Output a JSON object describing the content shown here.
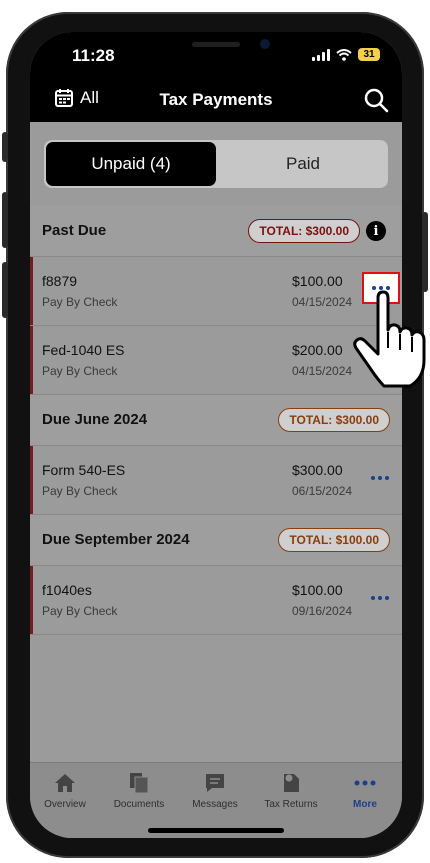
{
  "status_bar": {
    "time": "11:28",
    "battery": "31"
  },
  "nav": {
    "left_label": "All",
    "title": "Tax Payments"
  },
  "segment": {
    "unpaid": "Unpaid (4)",
    "paid": "Paid"
  },
  "sections": [
    {
      "title": "Past Due",
      "total": "TOTAL: $300.00",
      "rows": [
        {
          "name": "f8879",
          "method": "Pay By Check",
          "amount": "$100.00",
          "date": "04/15/2024"
        },
        {
          "name": "Fed-1040 ES",
          "method": "Pay By Check",
          "amount": "$200.00",
          "date": "04/15/2024"
        }
      ]
    },
    {
      "title": "Due June 2024",
      "total": "TOTAL: $300.00",
      "rows": [
        {
          "name": "Form 540-ES",
          "method": "Pay By Check",
          "amount": "$300.00",
          "date": "06/15/2024"
        }
      ]
    },
    {
      "title": "Due September 2024",
      "total": "TOTAL: $100.00",
      "rows": [
        {
          "name": "f1040es",
          "method": "Pay By Check",
          "amount": "$100.00",
          "date": "09/16/2024"
        }
      ]
    }
  ],
  "tabbar": [
    {
      "label": "Overview",
      "icon": "home-icon"
    },
    {
      "label": "Documents",
      "icon": "documents-icon"
    },
    {
      "label": "Messages",
      "icon": "messages-icon"
    },
    {
      "label": "Tax Returns",
      "icon": "tax-returns-icon"
    },
    {
      "label": "More",
      "icon": "more-icon"
    }
  ],
  "colors": {
    "accent": "#1c3f8a",
    "past_due": "#7a1010",
    "due": "#8a3d0a",
    "highlight": "#dd1111"
  }
}
